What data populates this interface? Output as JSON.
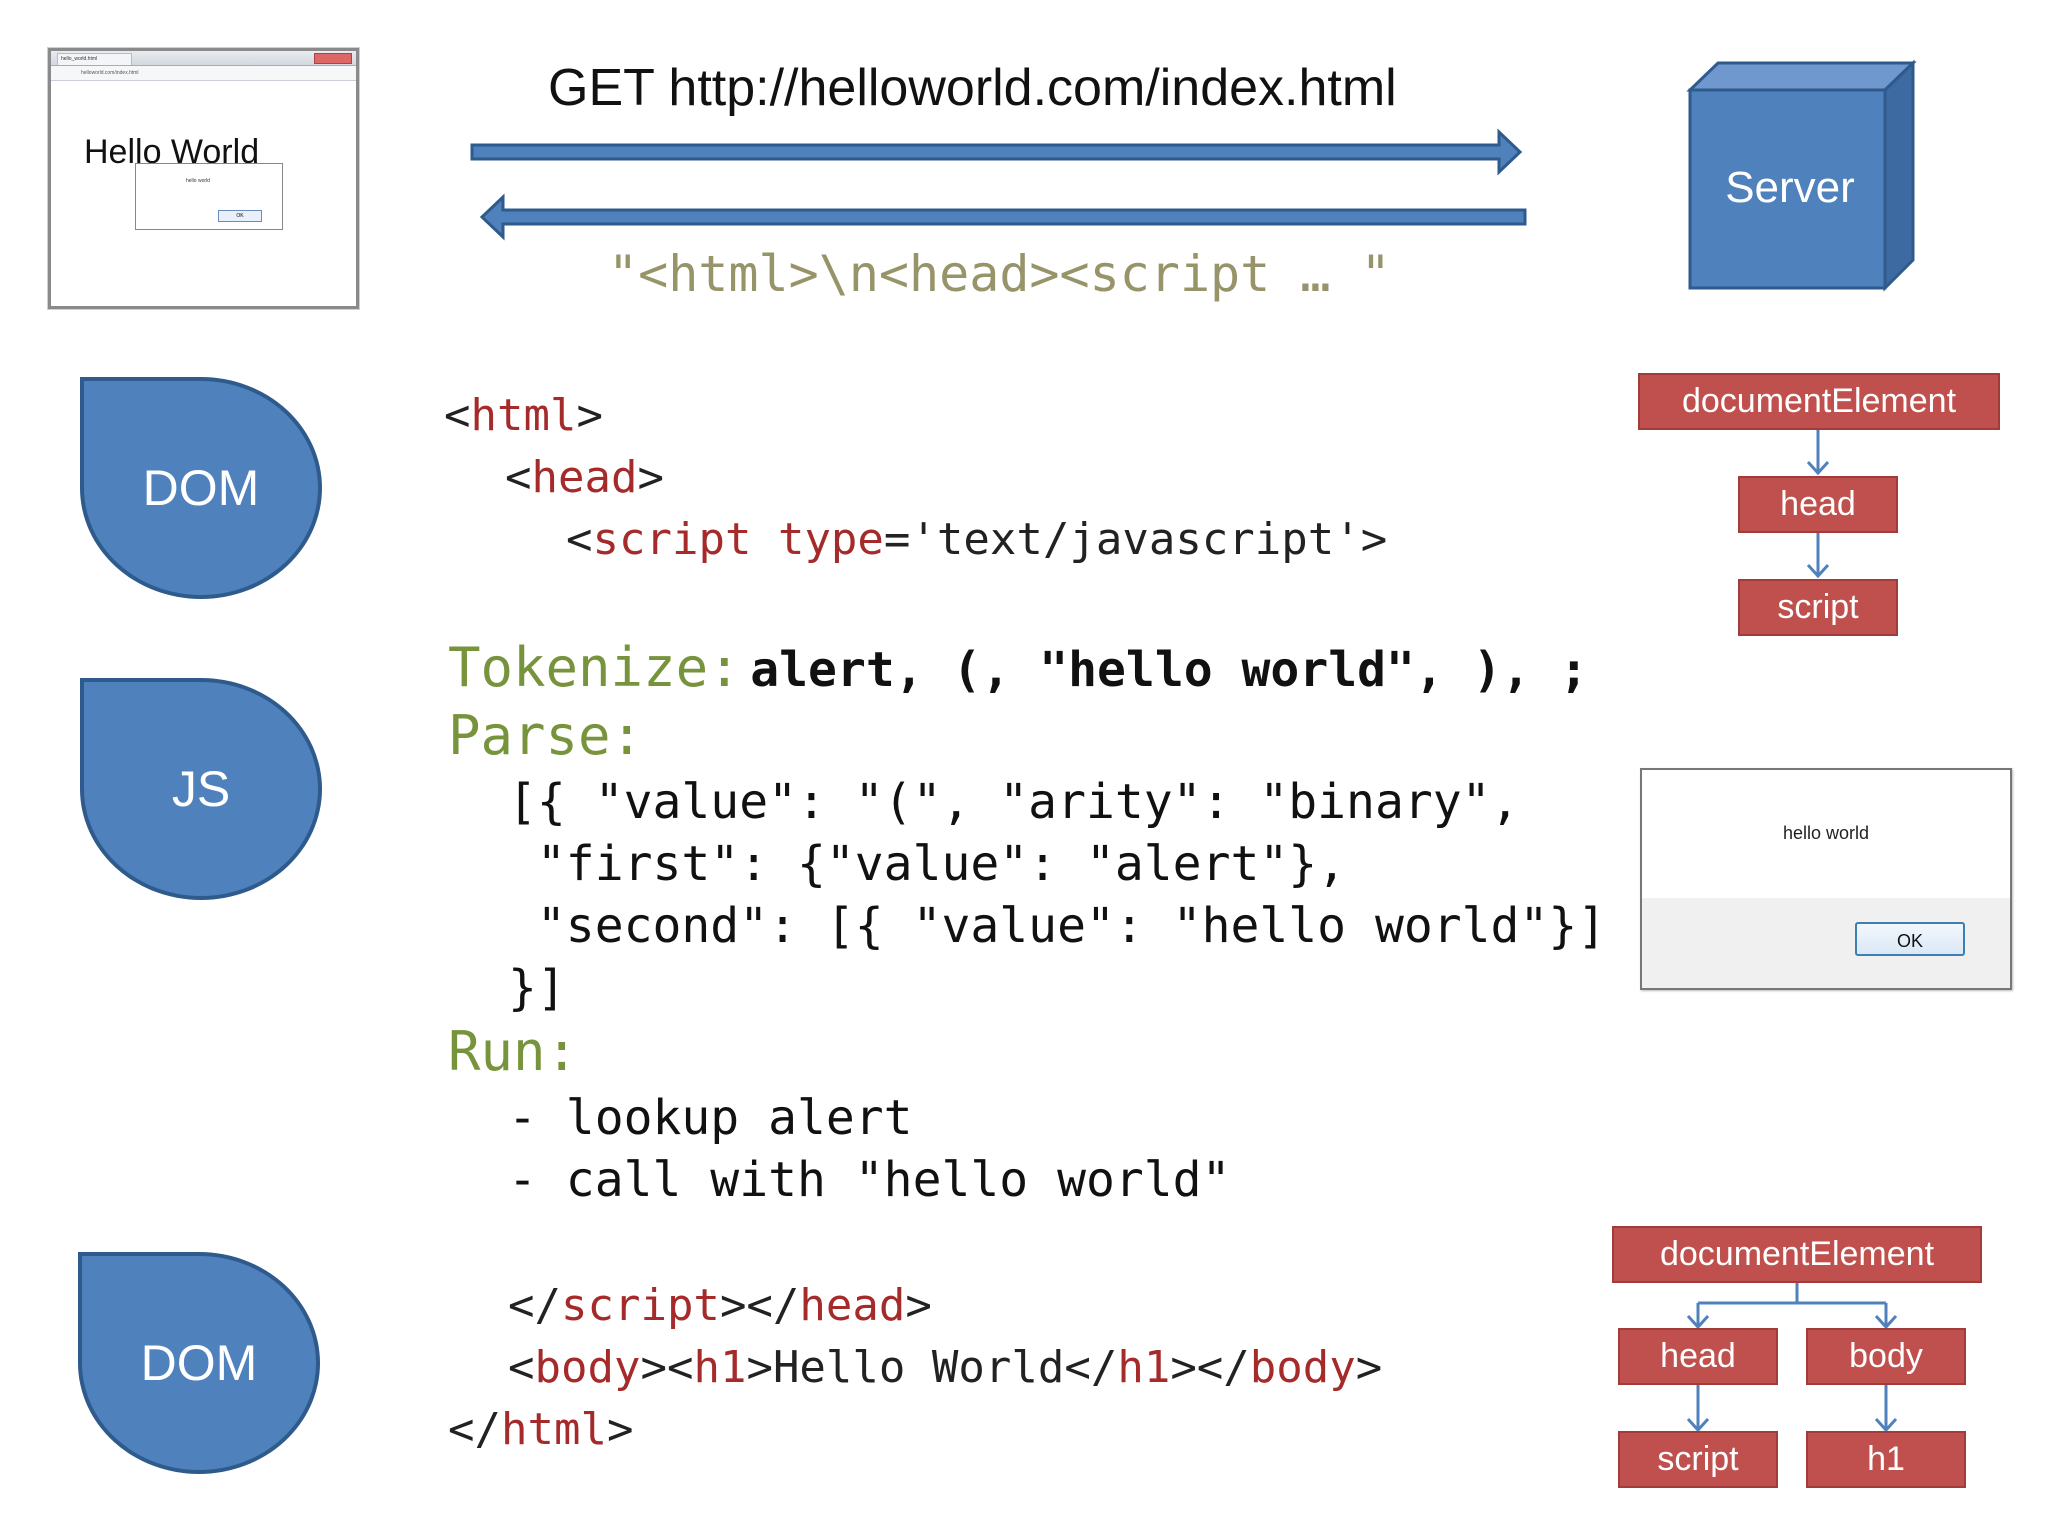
{
  "browser": {
    "tab_title": "hello_world.html",
    "address": "helloworld.com/index.html",
    "heading": "Hello World",
    "dialog_message": "hello world",
    "dialog_ok": "OK"
  },
  "request": {
    "label": "GET http://helloworld.com/index.html",
    "response": "\"<html>\\n<head><script … \""
  },
  "server": {
    "label": "Server"
  },
  "phases": {
    "dom1": "DOM",
    "js": "JS",
    "dom2": "DOM"
  },
  "html_code": {
    "line1_tag": "html",
    "line2_tag": "head",
    "line3_tag": "script",
    "line3_attr": "type",
    "line3_value": "'text/javascript'"
  },
  "js_steps": {
    "tokenize_label": "Tokenize:",
    "tokenize_tokens": "alert, (, \"hello world\", ), ;",
    "parse_label": "Parse:",
    "parse_lines": [
      "[{ \"value\": \"(\", \"arity\": \"binary\",",
      " \"first\": {\"value\": \"alert\"},",
      " \"second\": [{ \"value\": \"hello world\"}]",
      "}]"
    ],
    "run_label": "Run:",
    "run_lines": [
      "- lookup alert",
      "- call with \"hello world\""
    ]
  },
  "closing_code": {
    "script_tag": "script",
    "head_tag": "head",
    "body_tag": "body",
    "h1_tag": "h1",
    "h1_text": "Hello World",
    "html_tag": "html"
  },
  "tree1": {
    "root": "documentElement",
    "child": "head",
    "grandchild": "script"
  },
  "alert_dialog": {
    "message": "hello world",
    "ok": "OK"
  },
  "tree2": {
    "root": "documentElement",
    "left": "head",
    "right": "body",
    "left_child": "script",
    "right_child": "h1"
  },
  "colors": {
    "blue_fill": "#4f81bd",
    "blue_border": "#2f5a8c",
    "node_red": "#c0504d",
    "tag_red": "#a52a2a",
    "step_green": "#77933c",
    "response_olive": "#98946a"
  }
}
